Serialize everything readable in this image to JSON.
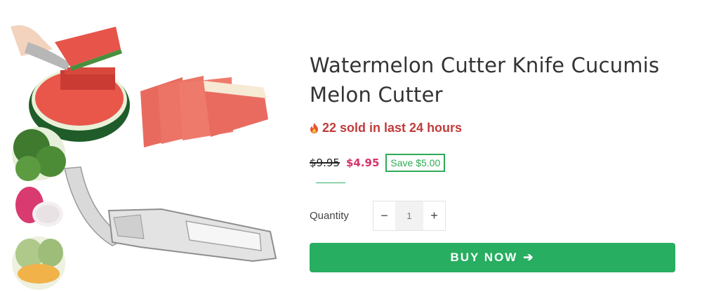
{
  "product": {
    "title": "Watermelon Cutter Knife Cucumis Melon Cutter",
    "sold_text": "22 sold in last 24 hours",
    "compare_price": "$9.95",
    "sale_price": "$4.95",
    "save_badge": "Save $5.00"
  },
  "quantity": {
    "label": "Quantity",
    "minus": "−",
    "value": "1",
    "plus": "+"
  },
  "buy": {
    "label": "BUY NOW",
    "arrow": "➔"
  },
  "colors": {
    "buy_button": "#27ae60",
    "sale_price": "#d6336c",
    "sold_text": "#c23b3b",
    "save_badge": "#2faa55"
  },
  "gallery": {
    "images": [
      "watermelon-hero-image",
      "watermelon-thumbnail",
      "dragon-fruit-thumbnail",
      "melon-thumbnail",
      "cutter-tool-image"
    ]
  }
}
